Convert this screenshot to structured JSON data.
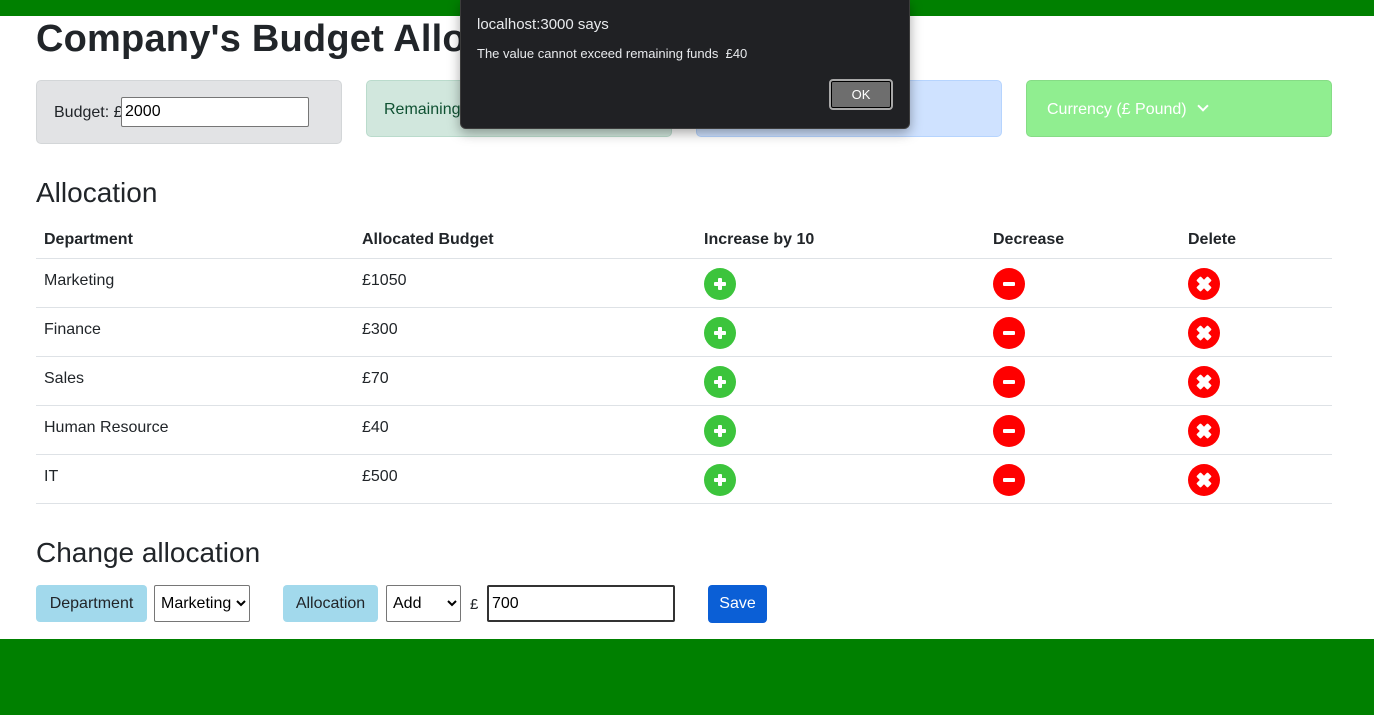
{
  "header": {
    "title": "Company's Budget Allo"
  },
  "budget": {
    "label": "Budget: £",
    "value": "2000"
  },
  "remaining": {
    "label": "Remaining:"
  },
  "currency": {
    "label": "Currency (£ Pound)"
  },
  "allocation": {
    "title": "Allocation",
    "headers": [
      "Department",
      "Allocated Budget",
      "Increase by 10",
      "Decrease",
      "Delete"
    ],
    "rows": [
      {
        "department": "Marketing",
        "budget": "£1050"
      },
      {
        "department": "Finance",
        "budget": "£300"
      },
      {
        "department": "Sales",
        "budget": "£70"
      },
      {
        "department": "Human Resource",
        "budget": "£40"
      },
      {
        "department": "IT",
        "budget": "£500"
      }
    ]
  },
  "change": {
    "title": "Change allocation",
    "department_label": "Department",
    "department_selected": "Marketing",
    "allocation_label": "Allocation",
    "action_selected": "Add",
    "currency_symbol": "£",
    "amount_value": "700",
    "save_label": "Save"
  },
  "dialog": {
    "origin": "localhost:3000 says",
    "message": "The value cannot exceed remaining funds  £40",
    "ok_label": "OK"
  },
  "colors": {
    "top_bar": "#008000",
    "bottom_bar": "#008000",
    "increase": "#3cc43c",
    "decrease": "#ff0000",
    "delete": "#ff0000",
    "save_button": "#0b5fd6",
    "label_bg": "#a2d9ec"
  },
  "icons": {
    "increase": "plus-icon",
    "decrease": "minus-icon",
    "delete": "x-icon"
  }
}
